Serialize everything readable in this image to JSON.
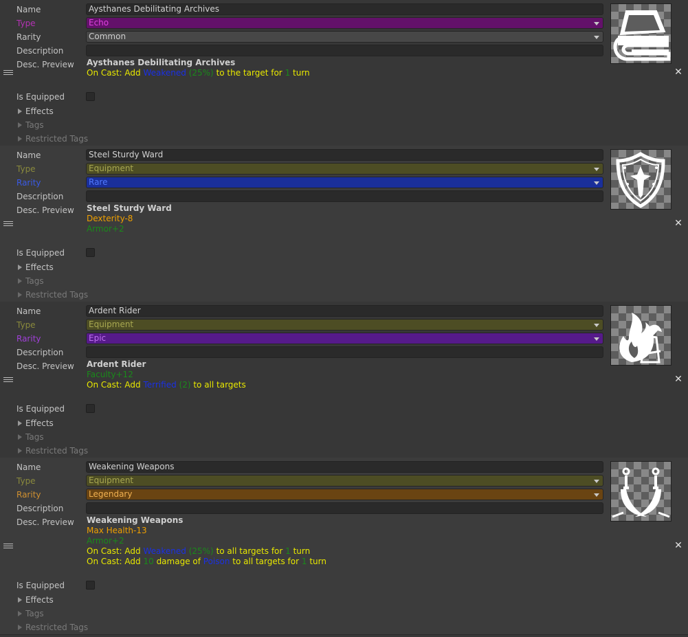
{
  "labels": {
    "name": "Name",
    "type": "Type",
    "rarity": "Rarity",
    "description": "Description",
    "desc_preview": "Desc. Preview",
    "is_equipped": "Is Equipped",
    "effects": "Effects",
    "tags": "Tags",
    "restricted_tags": "Restricted Tags"
  },
  "colors": {
    "echo": "#a032a8",
    "equipment": "#54542a",
    "common": "#3e3e3e",
    "rare": "#1e36b4",
    "epic": "#6a1ea0",
    "legendary": "#7a4a10",
    "preview_yellow": "#e8e800",
    "preview_orange": "#f0a000",
    "preview_green": "#1a8a1a",
    "preview_blue": "#1a30e6"
  },
  "items": [
    {
      "name": "Aysthanes Debilitating Archives",
      "type": "Echo",
      "rarity": "Common",
      "description": "",
      "icon": "book-stack-icon",
      "preview_title": "Aysthanes Debilitating Archives",
      "preview_lines": [
        [
          [
            "On Cast: Add ",
            "y"
          ],
          [
            "Weakened",
            "b"
          ],
          [
            " (25%)",
            "g"
          ],
          [
            " to the target for ",
            "y"
          ],
          [
            "1",
            "g"
          ],
          [
            " turn",
            "y"
          ]
        ]
      ]
    },
    {
      "name": "Steel Sturdy Ward",
      "type": "Equipment",
      "rarity": "Rare",
      "description": "",
      "icon": "shield-icon",
      "preview_title": "Steel Sturdy Ward",
      "preview_lines": [
        [
          [
            "Dexterity-8",
            "o"
          ]
        ],
        [
          [
            "Armor+2",
            "g"
          ]
        ]
      ]
    },
    {
      "name": "Ardent Rider",
      "type": "Equipment",
      "rarity": "Epic",
      "description": "",
      "icon": "flame-rider-icon",
      "preview_title": "Ardent Rider",
      "preview_lines": [
        [
          [
            "Faculty+12",
            "g"
          ]
        ],
        [
          [
            "On Cast: Add ",
            "y"
          ],
          [
            "Terrified",
            "b"
          ],
          [
            " (2)",
            "g"
          ],
          [
            " to all targets",
            "y"
          ]
        ]
      ]
    },
    {
      "name": "Weakening Weapons",
      "type": "Equipment",
      "rarity": "Legendary",
      "description": "",
      "icon": "crossed-scimitars-icon",
      "preview_title": "Weakening Weapons",
      "preview_lines": [
        [
          [
            "Max Health-13",
            "o"
          ]
        ],
        [
          [
            "Armor+2",
            "g"
          ]
        ],
        [
          [
            "On Cast: Add ",
            "y"
          ],
          [
            "Weakened",
            "b"
          ],
          [
            " (25%)",
            "g"
          ],
          [
            " to all targets for ",
            "y"
          ],
          [
            "1",
            "g"
          ],
          [
            " turn",
            "y"
          ]
        ],
        [
          [
            "On Cast: Add ",
            "y"
          ],
          [
            "10",
            "g"
          ],
          [
            " damage of ",
            "y"
          ],
          [
            "Poison",
            "b"
          ],
          [
            " to all targets for ",
            "y"
          ],
          [
            "1",
            "g"
          ],
          [
            " turn",
            "y"
          ]
        ]
      ]
    }
  ]
}
